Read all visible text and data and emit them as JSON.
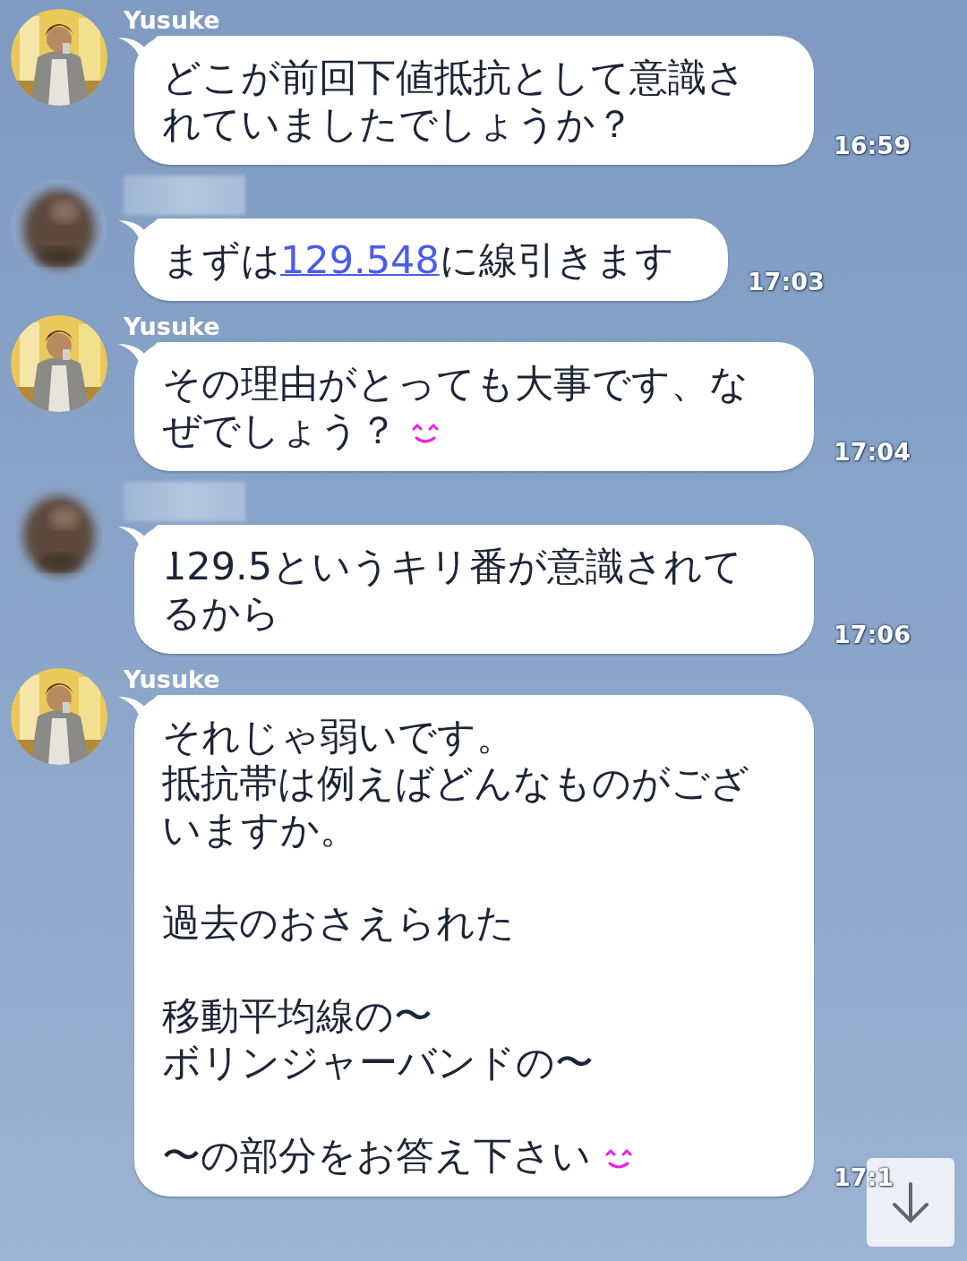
{
  "messages": [
    {
      "kind": "named",
      "sender": "Yusuke",
      "time": "16:59",
      "parts": [
        {
          "kind": "text",
          "text": "どこが前回下値抵抗として意識されていましたでしょうか？"
        }
      ]
    },
    {
      "kind": "blurred",
      "time": "17:03",
      "parts": [
        {
          "kind": "text",
          "text": "まずは"
        },
        {
          "kind": "link",
          "text": "129.548"
        },
        {
          "kind": "text",
          "text": "に線引きます"
        }
      ]
    },
    {
      "kind": "named",
      "sender": "Yusuke",
      "time": "17:04",
      "parts": [
        {
          "kind": "text",
          "text": "その理由がとっても大事です、なぜでしょう？ "
        },
        {
          "kind": "emoji"
        }
      ]
    },
    {
      "kind": "blurred",
      "time": "17:06",
      "parts": [
        {
          "kind": "text",
          "text": "129.5というキリ番が意識されてるから"
        }
      ]
    },
    {
      "kind": "named",
      "sender": "Yusuke",
      "time": "17:1",
      "parts": [
        {
          "kind": "line",
          "text": "それじゃ弱いです。"
        },
        {
          "kind": "line",
          "text": "抵抗帯は例えばどんなものがございますか。"
        },
        {
          "kind": "blank"
        },
        {
          "kind": "line",
          "text": "過去のおさえられた"
        },
        {
          "kind": "blank"
        },
        {
          "kind": "line",
          "text": "移動平均線の〜"
        },
        {
          "kind": "line",
          "text": "ボリンジャーバンドの〜"
        },
        {
          "kind": "blank"
        },
        {
          "kind": "line",
          "text": "〜の部分をお答え下さい "
        },
        {
          "kind": "emoji"
        }
      ]
    }
  ]
}
